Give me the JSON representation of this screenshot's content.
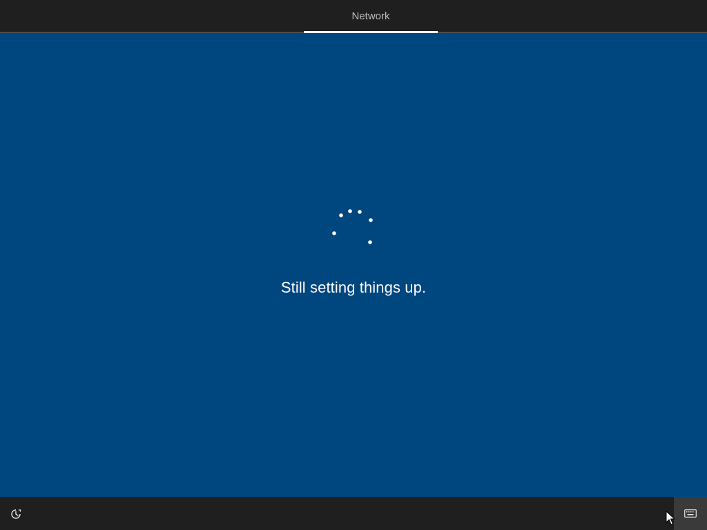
{
  "header": {
    "tabs": [
      {
        "label": "Network",
        "active": true
      }
    ]
  },
  "main": {
    "status_text": "Still setting things up.",
    "background_color": "#00467f"
  },
  "footer": {
    "ease_of_access_icon": "ease-of-access-icon",
    "keyboard_icon": "keyboard-icon"
  },
  "colors": {
    "bar": "#1f1f1f",
    "accent_underline": "#ffffff",
    "text": "#ffffff"
  }
}
